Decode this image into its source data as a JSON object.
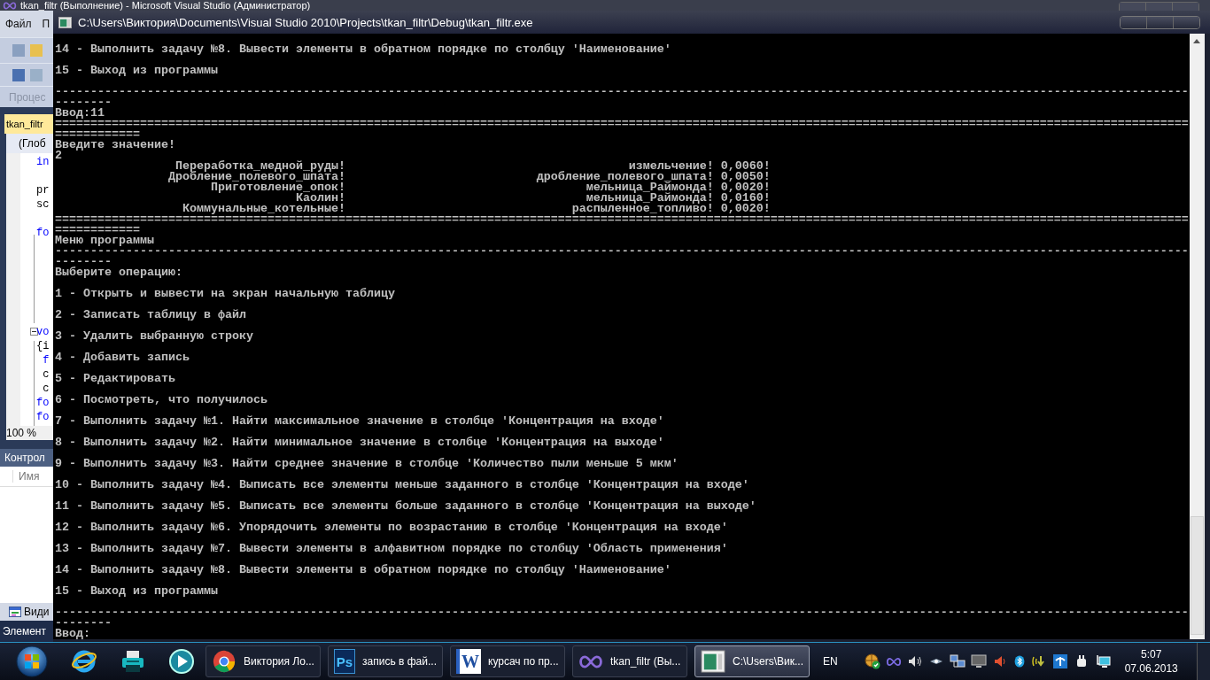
{
  "ide": {
    "title": "tkan_filtr (Выполнение) - Microsoft Visual Studio (Администратор)",
    "menu": [
      "Файл",
      "П"
    ],
    "toolbar_label": "Процес",
    "document_tab": "tkan_filtr",
    "scope": "(Глоб",
    "code_lines": [
      {
        "kind": "keyword",
        "text": "in"
      },
      {
        "kind": "blank"
      },
      {
        "kind": "plain",
        "text": "pr"
      },
      {
        "kind": "plain",
        "text": "sc"
      },
      {
        "kind": "blank"
      },
      {
        "kind": "keyword",
        "text": "fo"
      },
      {
        "kind": "blank"
      },
      {
        "kind": "blank"
      },
      {
        "kind": "blank"
      },
      {
        "kind": "blank"
      },
      {
        "kind": "blank"
      },
      {
        "kind": "blank"
      },
      {
        "kind": "keyword",
        "text": "vo"
      },
      {
        "kind": "plain",
        "text": "{i"
      },
      {
        "kind": "keyword",
        "text": " f"
      },
      {
        "kind": "plain",
        "text": " c"
      },
      {
        "kind": "plain",
        "text": " c"
      },
      {
        "kind": "keyword",
        "text": "fo"
      },
      {
        "kind": "keyword",
        "text": "fo"
      }
    ],
    "zoom": "100 %",
    "panel_title": "Контрол",
    "panel_column": "Имя",
    "bottom_tab": "Види",
    "status": "Элемент"
  },
  "console": {
    "title": "C:\\Users\\Виктория\\Documents\\Visual Studio 2010\\Projects\\tkan_filtr\\Debug\\tkan_filtr.exe",
    "lines": [
      {
        "kind": "blank"
      },
      {
        "kind": "text",
        "text": "14 - Выполнить задачу №8. Вывести элементы в обратном порядке по столбцу 'Наименование'"
      },
      {
        "kind": "blank"
      },
      {
        "kind": "text",
        "text": "15 - Выход из программы"
      },
      {
        "kind": "blank"
      },
      {
        "kind": "text",
        "text": "----------------------------------------------------------------------------------------------------------------------------------------------------------------"
      },
      {
        "kind": "text",
        "text": "--------"
      },
      {
        "kind": "text",
        "text": "Ввод:11"
      },
      {
        "kind": "text",
        "text": "================================================================================================================================================================"
      },
      {
        "kind": "text",
        "text": "============"
      },
      {
        "kind": "text",
        "text": "Введите значение!"
      },
      {
        "kind": "text",
        "text": "2"
      },
      {
        "kind": "row",
        "name": "Переработка_медной_руды!",
        "process": "измельчение!",
        "value": "0,0060!"
      },
      {
        "kind": "row",
        "name": "Дробление_полевого_шпата!",
        "process": "дробление_полевого_шпата!",
        "value": "0,0050!"
      },
      {
        "kind": "row",
        "name": "Приготовление_опок!",
        "process": "мельница_Раймонда!",
        "value": "0,0020!"
      },
      {
        "kind": "row",
        "name": "Каолин!",
        "process": "мельница_Раймонда!",
        "value": "0,0160!"
      },
      {
        "kind": "row",
        "name": "Коммунальные_котельные!",
        "process": "распыленное_топливо!",
        "value": "0,0020!"
      },
      {
        "kind": "text",
        "text": "================================================================================================================================================================"
      },
      {
        "kind": "text",
        "text": "============"
      },
      {
        "kind": "text",
        "text": "Меню программы"
      },
      {
        "kind": "text",
        "text": "----------------------------------------------------------------------------------------------------------------------------------------------------------------"
      },
      {
        "kind": "text",
        "text": "--------"
      },
      {
        "kind": "text",
        "text": "Выберите операцию:"
      },
      {
        "kind": "blank"
      },
      {
        "kind": "text",
        "text": "1 - Открыть и вывести на экран начальную таблицу"
      },
      {
        "kind": "blank"
      },
      {
        "kind": "text",
        "text": "2 - Записать таблицу в файл"
      },
      {
        "kind": "blank"
      },
      {
        "kind": "text",
        "text": "3 - Удалить выбранную строку"
      },
      {
        "kind": "blank"
      },
      {
        "kind": "text",
        "text": "4 - Добавить запись"
      },
      {
        "kind": "blank"
      },
      {
        "kind": "text",
        "text": "5 - Редактировать"
      },
      {
        "kind": "blank"
      },
      {
        "kind": "text",
        "text": "6 - Посмотреть, что получилось"
      },
      {
        "kind": "blank"
      },
      {
        "kind": "text",
        "text": "7 - Выполнить задачу №1. Найти максимальное значение в столбце 'Концентрация на входе'"
      },
      {
        "kind": "blank"
      },
      {
        "kind": "text",
        "text": "8 - Выполнить задачу №2. Найти минимальное значение в столбце 'Концентрация на выходе'"
      },
      {
        "kind": "blank"
      },
      {
        "kind": "text",
        "text": "9 - Выполнить задачу №3. Найти среднее значение в столбце 'Количество пыли меньше 5 мкм'"
      },
      {
        "kind": "blank"
      },
      {
        "kind": "text",
        "text": "10 - Выполнить задачу №4. Выписать все элементы меньше заданного в столбце 'Концентрация на входе'"
      },
      {
        "kind": "blank"
      },
      {
        "kind": "text",
        "text": "11 - Выполнить задачу №5. Выписать все элементы больше заданного в столбце 'Концентрация на выходе'"
      },
      {
        "kind": "blank"
      },
      {
        "kind": "text",
        "text": "12 - Выполнить задачу №6. Упорядочить элементы по возрастанию в столбце 'Концентрация на входе'"
      },
      {
        "kind": "blank"
      },
      {
        "kind": "text",
        "text": "13 - Выполнить задачу №7. Вывести элементы в алфавитном порядке по столбцу 'Область применения'"
      },
      {
        "kind": "blank"
      },
      {
        "kind": "text",
        "text": "14 - Выполнить задачу №8. Вывести элементы в обратном порядке по столбцу 'Наименование'"
      },
      {
        "kind": "blank"
      },
      {
        "kind": "text",
        "text": "15 - Выход из программы"
      },
      {
        "kind": "blank"
      },
      {
        "kind": "text",
        "text": "----------------------------------------------------------------------------------------------------------------------------------------------------------------"
      },
      {
        "kind": "text",
        "text": "--------"
      },
      {
        "kind": "text",
        "text": "Ввод:"
      }
    ]
  },
  "taskbar": {
    "buttons": [
      {
        "kind": "browser",
        "label": "Виктория Ло...",
        "selected": false
      },
      {
        "kind": "photo",
        "badge": "Ps",
        "label": "запись в фай...",
        "selected": false
      },
      {
        "kind": "word",
        "badge": "W",
        "label": "курсач по пр...",
        "selected": false
      },
      {
        "kind": "studio",
        "label": "tkan_filtr (Вы...",
        "selected": false
      },
      {
        "kind": "console",
        "label": "C:\\Users\\Вик...",
        "selected": true
      }
    ],
    "language": "EN",
    "time": "5:07",
    "date": "07.06.2013"
  }
}
